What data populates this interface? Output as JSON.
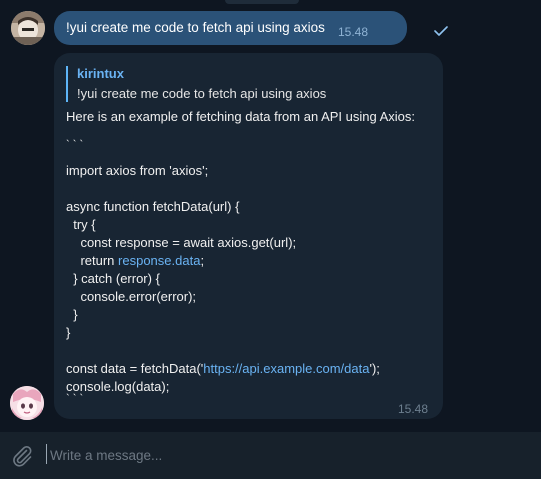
{
  "messages": {
    "outgoing": {
      "text": "!yui create me code to fetch api using axios",
      "time": "15.48"
    },
    "incoming": {
      "reply_author": "kirintux",
      "reply_text": "!yui create me code to fetch api using axios",
      "intro": "Here is an example of fetching data from an API using Axios:",
      "code": {
        "fence_open": "` ` `",
        "import_line": "import axios from 'axios';",
        "fn_decl": "async function fetchData(url) {",
        "try_open": "  try {",
        "const_response": "    const response = await axios.get(url);",
        "return_prefix": "    return ",
        "return_link": "response.data",
        "return_suffix": ";",
        "catch_line": "  } catch (error) {",
        "console_error": "    console.error(error);",
        "inner_close": "  }",
        "fn_close": "}",
        "data_prefix": "const data = fetchData('",
        "data_link": "https://api.example.com/data",
        "data_suffix": "');",
        "console_log": "console.log(data);",
        "fence_close": "` ` `"
      },
      "time": "15.48"
    }
  },
  "composer": {
    "placeholder": "Write a message..."
  },
  "icons": {
    "attach": "paperclip-icon",
    "read_status": "check-icon"
  },
  "colors": {
    "background": "#0e1621",
    "outgoing_bubble": "#2b5278",
    "incoming_bubble": "#182533",
    "link": "#6ab3f3",
    "composer_bg": "#17212b"
  }
}
